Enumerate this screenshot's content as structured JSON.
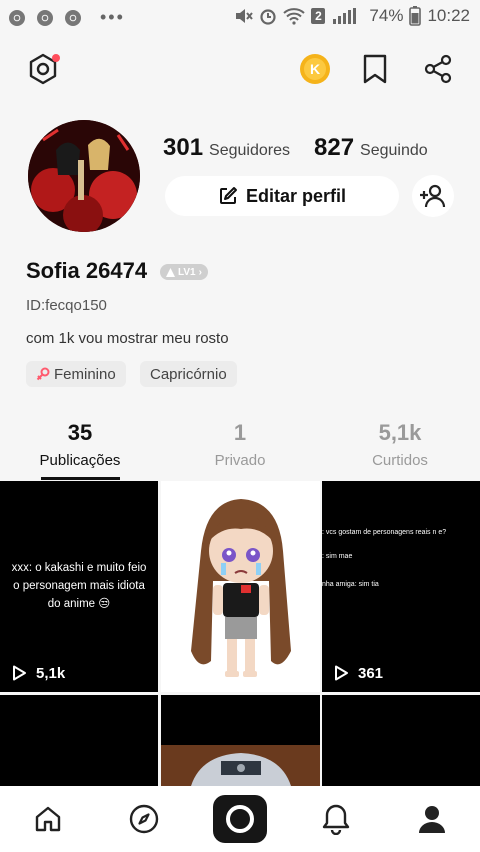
{
  "status_bar": {
    "battery": "74%",
    "time": "10:22",
    "sim_badge": "2"
  },
  "profile": {
    "followers_count": "301",
    "followers_label": "Seguidores",
    "following_count": "827",
    "following_label": "Seguindo",
    "edit_label": "Editar perfil",
    "username": "Sofia 26474",
    "level": "LV1",
    "user_id": "ID:fecqo150",
    "bio": "com 1k vou mostrar meu rosto",
    "tags": [
      "Feminino",
      "Capricórnio"
    ]
  },
  "stats": [
    {
      "value": "35",
      "label": "Publicações",
      "active": true
    },
    {
      "value": "1",
      "label": "Privado",
      "active": false
    },
    {
      "value": "5,1k",
      "label": "Curtidos",
      "active": false
    }
  ],
  "posts": [
    {
      "caption": "xxx: o kakashi e muito feio o personagem mais idiota do anime 😒",
      "plays": "5,1k"
    },
    {
      "caption": "",
      "plays": ""
    },
    {
      "lines": [
        ": vcs gostam de personagens reais n e?",
        ": sim mae",
        "nha amiga: sim tia"
      ],
      "plays": "361"
    }
  ],
  "colors": {
    "accent_dot": "#ff4d5b",
    "coin": "#f5b31a",
    "muted": "#9a9a9a"
  }
}
